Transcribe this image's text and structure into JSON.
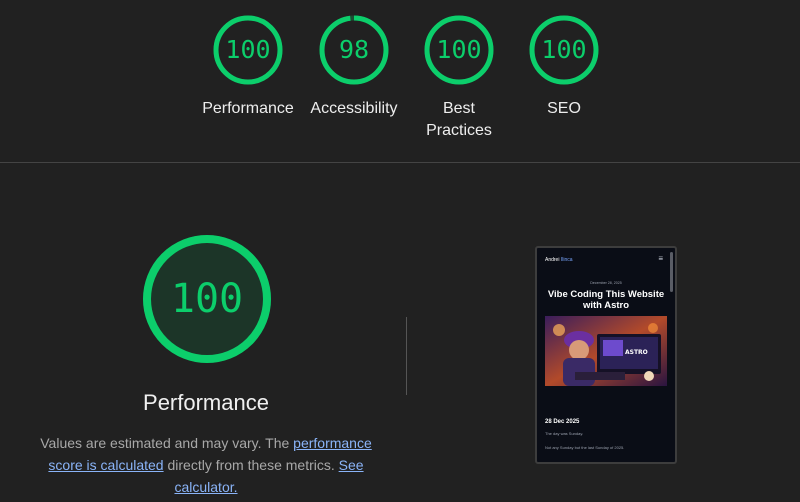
{
  "categories": [
    {
      "label": "Performance",
      "score": "100",
      "fraction": 1.0
    },
    {
      "label": "Accessibility",
      "score": "98",
      "fraction": 0.98
    },
    {
      "label": "Best Practices",
      "score": "100",
      "fraction": 1.0
    },
    {
      "label": "SEO",
      "score": "100",
      "fraction": 1.0
    }
  ],
  "main": {
    "score": "100",
    "fraction": 1.0,
    "title": "Performance",
    "desc_prefix": "Values are estimated and may vary. The ",
    "desc_link1": "performance score is calculated",
    "desc_middle": " directly from these metrics. ",
    "desc_link2": "See calculator."
  },
  "screenshot": {
    "brand_first": "Andrei",
    "brand_last": "Ilinca",
    "menu_icon": "hamburger-icon",
    "date": "December 28, 2025",
    "title": "Vibe Coding This Website with Astro",
    "post_date": "28 Dec 2025",
    "p1": "The day was Sunday.",
    "p2": "Not any Sunday but the last Sunday of 2025."
  },
  "colors": {
    "pass": "#0cce6b",
    "background": "#212121",
    "link": "#8ab4f8"
  }
}
